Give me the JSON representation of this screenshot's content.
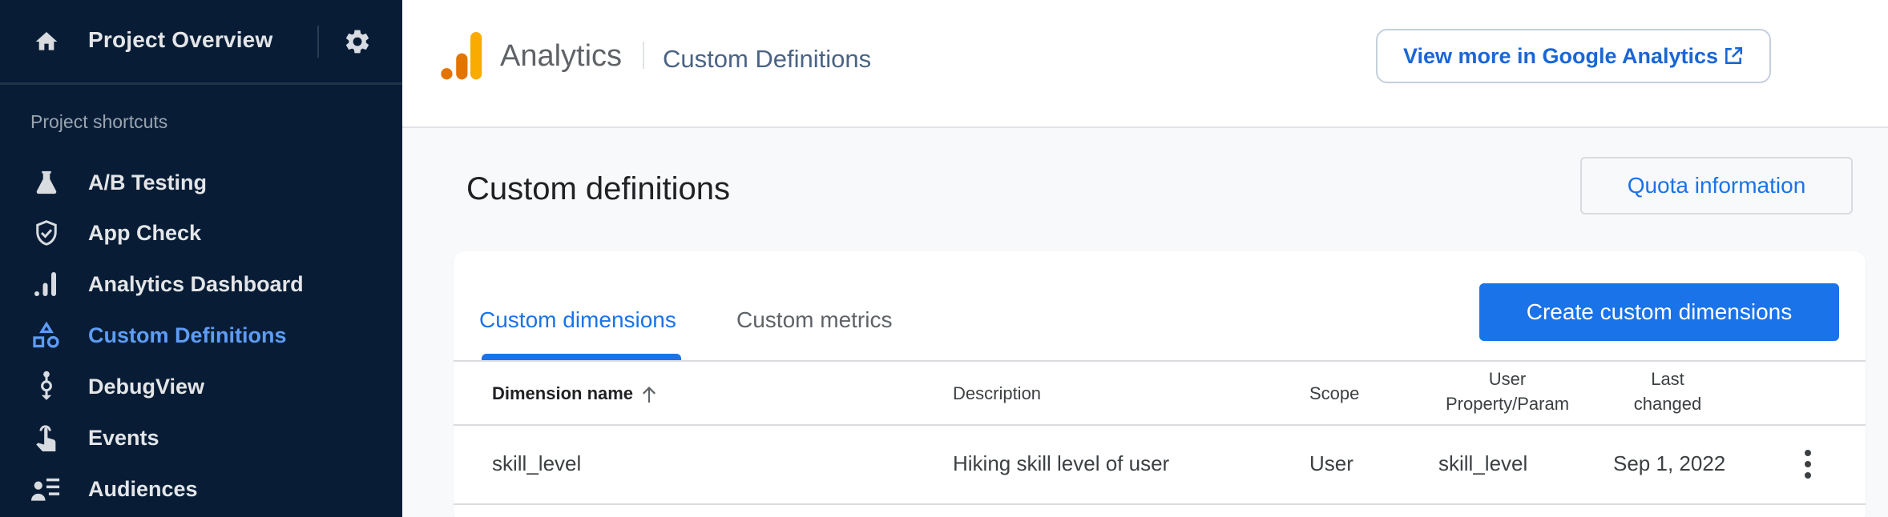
{
  "sidebar": {
    "project_title": "Project Overview",
    "section_label": "Project shortcuts",
    "items": [
      {
        "label": "A/B Testing",
        "icon": "flask-icon",
        "active": false
      },
      {
        "label": "App Check",
        "icon": "shield-check-icon",
        "active": false
      },
      {
        "label": "Analytics Dashboard",
        "icon": "bar-chart-icon",
        "active": false
      },
      {
        "label": "Custom Definitions",
        "icon": "shapes-icon",
        "active": true
      },
      {
        "label": "DebugView",
        "icon": "debug-icon",
        "active": false
      },
      {
        "label": "Events",
        "icon": "touch-icon",
        "active": false
      },
      {
        "label": "Audiences",
        "icon": "audience-list-icon",
        "active": false
      }
    ]
  },
  "header": {
    "product_name": "Analytics",
    "page_name": "Custom Definitions",
    "view_more_label": "View more in Google Analytics"
  },
  "page": {
    "title": "Custom definitions",
    "quota_label": "Quota information"
  },
  "tabs": [
    {
      "label": "Custom dimensions",
      "active": true
    },
    {
      "label": "Custom metrics",
      "active": false
    }
  ],
  "create_button_label": "Create custom dimensions",
  "table": {
    "columns": {
      "name": "Dimension name",
      "description": "Description",
      "scope": "Scope",
      "user_property_line1": "User",
      "user_property_line2": "Property/Param",
      "last_changed_line1": "Last",
      "last_changed_line2": "changed"
    },
    "sort": {
      "column": "Dimension name",
      "direction": "ascending"
    },
    "rows": [
      {
        "name": "skill_level",
        "description": "Hiking skill level of user",
        "scope": "User",
        "user_property": "skill_level",
        "last_changed": "Sep 1, 2022"
      }
    ]
  },
  "colors": {
    "sidebar_bg": "#081d35",
    "accent": "#1a73e8",
    "active_nav": "#5e9cf5",
    "logo_orange_dark": "#e37400",
    "logo_orange_light": "#f9ab00"
  }
}
